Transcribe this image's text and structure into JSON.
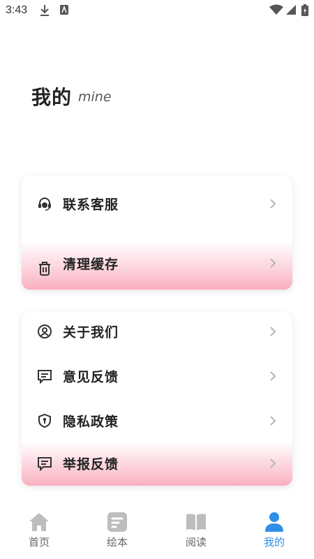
{
  "status_bar": {
    "time": "3:43",
    "icons": [
      "download-icon",
      "notification-app-icon",
      "wifi-icon",
      "cell-signal-icon",
      "battery-charging-icon"
    ]
  },
  "header": {
    "title": "我的",
    "subtitle": "mine"
  },
  "sections": [
    {
      "items": [
        {
          "label": "联系客服",
          "icon": "headset-icon"
        },
        {
          "label": "清理缓存",
          "icon": "trash-icon"
        }
      ]
    },
    {
      "items": [
        {
          "label": "关于我们",
          "icon": "user-circle-icon"
        },
        {
          "label": "意见反馈",
          "icon": "message-icon"
        },
        {
          "label": "隐私政策",
          "icon": "shield-icon"
        },
        {
          "label": "举报反馈",
          "icon": "message-icon"
        }
      ]
    }
  ],
  "bottom_nav": {
    "items": [
      {
        "label": "首页",
        "icon": "home-icon",
        "active": false
      },
      {
        "label": "绘本",
        "icon": "book-icon",
        "active": false
      },
      {
        "label": "阅读",
        "icon": "open-book-icon",
        "active": false
      },
      {
        "label": "我的",
        "icon": "person-icon",
        "active": true
      }
    ]
  },
  "colors": {
    "accent": "#2f8fe8",
    "inactive_icon": "#bdbdbd",
    "highlight_pink": "#f9aebf"
  }
}
